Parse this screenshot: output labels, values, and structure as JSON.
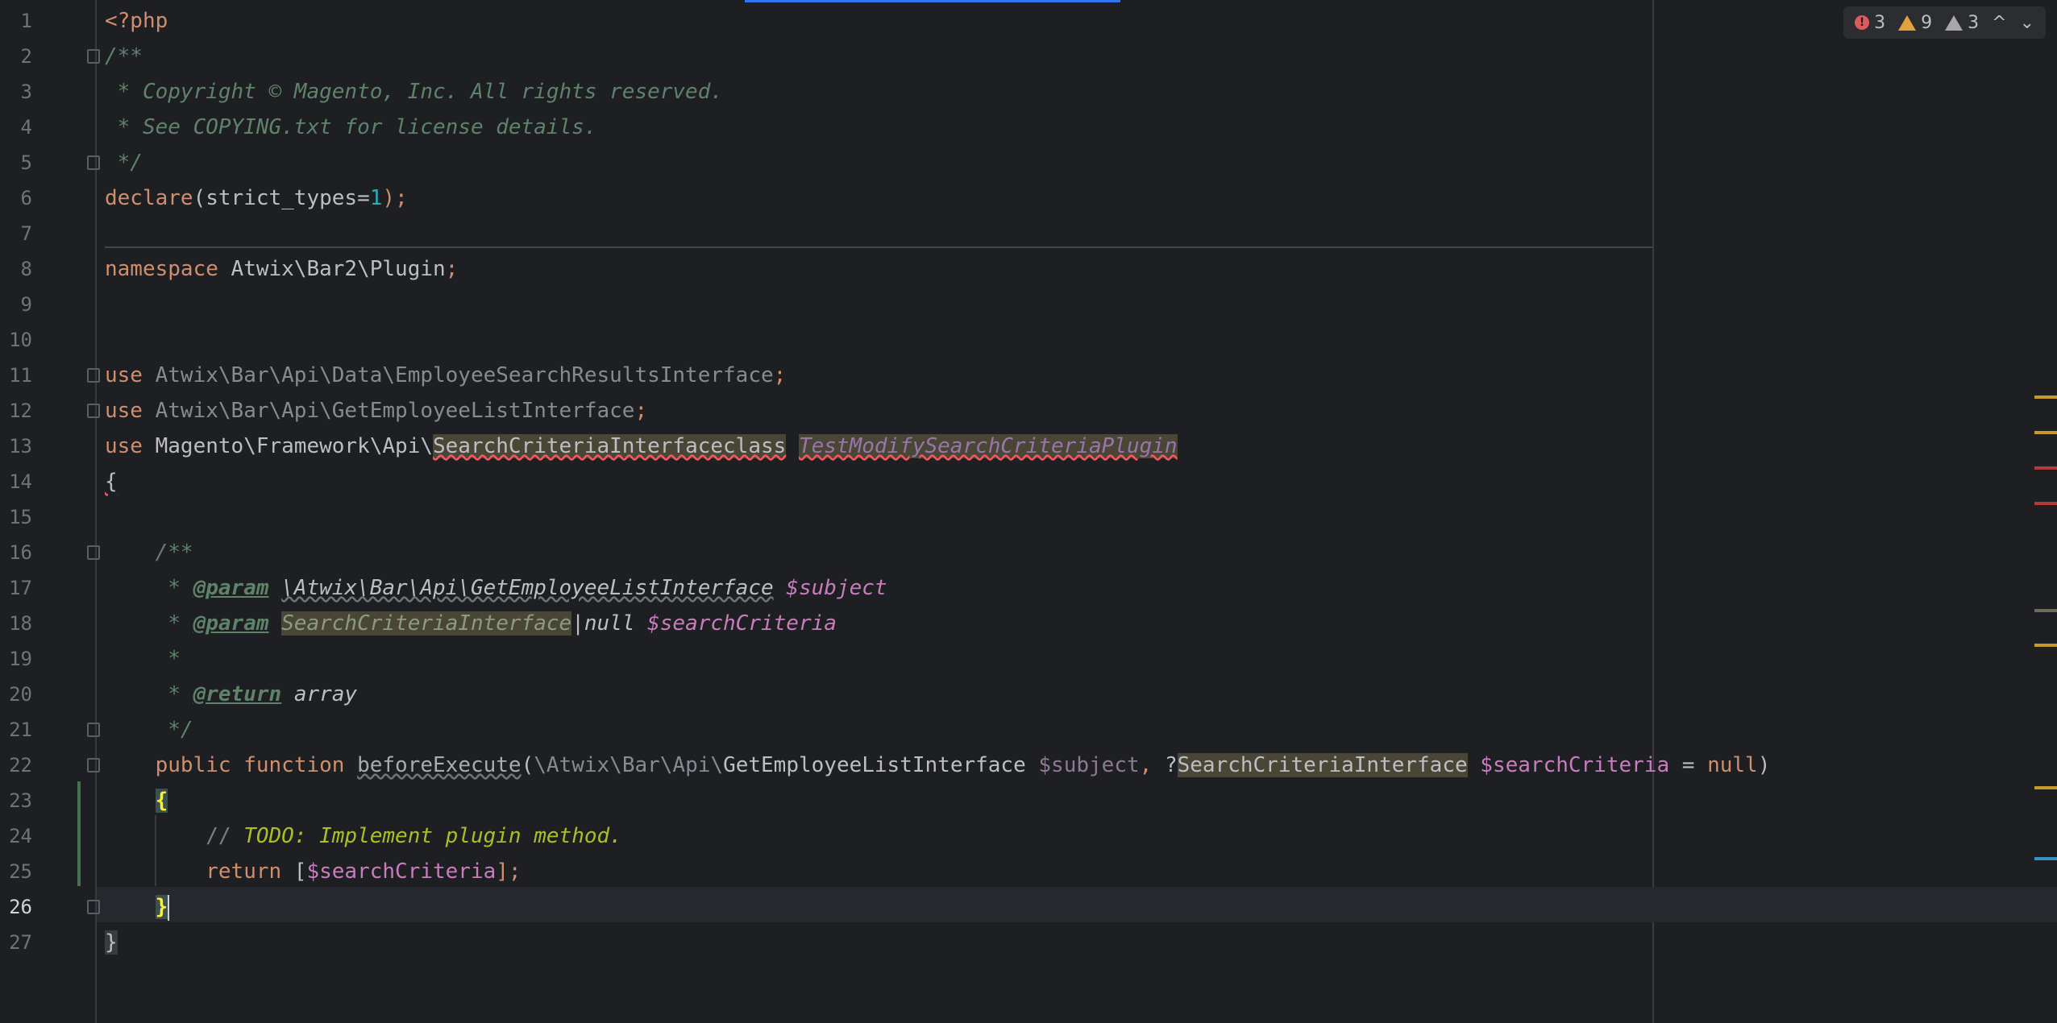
{
  "inspections": {
    "errors": "3",
    "warnings": "9",
    "weak_warnings": "3",
    "up_label": "^",
    "down_label": "⌄"
  },
  "lines": [
    {
      "n": "1"
    },
    {
      "n": "2"
    },
    {
      "n": "3"
    },
    {
      "n": "4"
    },
    {
      "n": "5"
    },
    {
      "n": "6"
    },
    {
      "n": "7"
    },
    {
      "n": "8"
    },
    {
      "n": "9"
    },
    {
      "n": "10"
    },
    {
      "n": "11"
    },
    {
      "n": "12"
    },
    {
      "n": "13"
    },
    {
      "n": "14"
    },
    {
      "n": "15"
    },
    {
      "n": "16"
    },
    {
      "n": "17"
    },
    {
      "n": "18"
    },
    {
      "n": "19"
    },
    {
      "n": "20"
    },
    {
      "n": "21"
    },
    {
      "n": "22"
    },
    {
      "n": "23"
    },
    {
      "n": "24"
    },
    {
      "n": "25"
    },
    {
      "n": "26"
    },
    {
      "n": "27"
    }
  ],
  "code": {
    "l1": "<?php",
    "l2": "/**",
    "l3": " * Copyright © Magento, Inc. All rights reserved.",
    "l4": " * See COPYING.txt for license details.",
    "l5": " */",
    "l6_kw": "declare",
    "l6_a": "(strict_types=",
    "l6_num": "1",
    "l6_b": ");",
    "l8_kw": "namespace",
    "l8_ns": " Atwix\\Bar2\\Plugin",
    "l8_end": ";",
    "l11_kw": "use",
    "l11_ns": " Atwix\\Bar\\Api\\Data\\EmployeeSearchResultsInterface",
    "l11_end": ";",
    "l12_kw": "use",
    "l12_ns": " Atwix\\Bar\\Api\\GetEmployeeListInterface",
    "l12_end": ";",
    "l13_kw": "use",
    "l13_ns": " Magento\\Framework\\Api\\",
    "l13_hl": "SearchCriteriaInterfaceclass",
    "l13_sp": " ",
    "l13_cls": "TestModifySearchCriteriaPlugin",
    "l14": "{",
    "l16": "    /**",
    "l17_a": "     * ",
    "l17_tag": "@param",
    "l17_b": " ",
    "l17_type": "\\Atwix\\Bar\\Api\\GetEmployeeListInterface",
    "l17_sp": " ",
    "l17_var": "$subject",
    "l18_a": "     * ",
    "l18_tag": "@param",
    "l18_b": " ",
    "l18_type": "SearchCriteriaInterface",
    "l18_c": "|null ",
    "l18_var": "$searchCriteria",
    "l19": "     *",
    "l20_a": "     * ",
    "l20_tag": "@return",
    "l20_b": " ",
    "l20_type": "array",
    "l21": "     */",
    "l22_ind": "    ",
    "l22_kw1": "public",
    "l22_sp1": " ",
    "l22_kw2": "function",
    "l22_sp2": " ",
    "l22_fn": "beforeExecute",
    "l22_a": "(",
    "l22_ns": "\\Atwix\\Bar\\Api\\",
    "l22_cls": "GetEmployeeListInterface",
    "l22_sp3": " ",
    "l22_v1": "$subject",
    "l22_comma": ", ",
    "l22_q": "?",
    "l22_hl": "SearchCriteriaInterface",
    "l22_sp4": " ",
    "l22_v2": "$searchCriteria",
    "l22_eq": " = ",
    "l22_null": "null",
    "l22_close": ")",
    "l23_ind": "    ",
    "l23_brace": "{",
    "l24_ind": "        ",
    "l24_slash": "// ",
    "l24_todo": "TODO: Implement plugin method.",
    "l25_ind": "        ",
    "l25_kw": "return",
    "l25_a": " [",
    "l25_var": "$searchCriteria",
    "l25_b": "];",
    "l26_ind": "    ",
    "l26_brace": "}",
    "l27": "}"
  },
  "colors": {
    "background": "#1e1f22",
    "keyword": "#cf8e6d",
    "comment": "#5f826b",
    "variable": "#c77dbb",
    "number": "#2aacb8",
    "todo": "#a8c023",
    "error": "#db5c5c",
    "warning": "#e0a13e"
  }
}
